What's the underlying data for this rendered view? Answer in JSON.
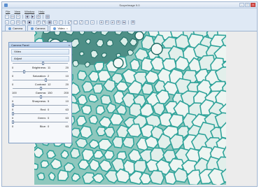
{
  "window": {
    "title": "ScopeImage 9.0",
    "minimize": "–",
    "maximize": "□",
    "close": "×"
  },
  "menu": [
    "File",
    "View",
    "Window",
    "Help"
  ],
  "toolbar": [
    {
      "icon": "new-icon",
      "glyph": "▫"
    },
    {
      "icon": "open-icon",
      "glyph": "▭"
    },
    {
      "icon": "save-icon",
      "glyph": "▪"
    },
    {
      "icon": "camera-icon",
      "glyph": "◉"
    },
    {
      "icon": "video-icon",
      "glyph": "▶"
    },
    {
      "icon": "snap-icon",
      "glyph": "◎"
    },
    {
      "icon": "print-icon",
      "glyph": "▤"
    }
  ],
  "toolbar2": [
    {
      "icon": "back-icon",
      "glyph": "←"
    },
    {
      "icon": "forward-icon",
      "glyph": "→"
    },
    {
      "icon": "cut-icon",
      "glyph": "✂"
    },
    {
      "icon": "copy-icon",
      "glyph": "❐"
    },
    {
      "icon": "paste-icon",
      "glyph": "▣"
    },
    {
      "icon": "undo-icon",
      "glyph": "↶"
    },
    {
      "icon": "redo-icon",
      "glyph": "↷"
    },
    {
      "icon": "grid-icon",
      "glyph": "▦"
    },
    {
      "icon": "zoom-in-icon",
      "glyph": "+"
    },
    {
      "icon": "zoom-out-icon",
      "glyph": "−"
    },
    {
      "icon": "fit-icon",
      "glyph": "⤢"
    },
    {
      "icon": "select-icon",
      "glyph": "⬚"
    },
    {
      "icon": "line-icon",
      "glyph": "╱"
    },
    {
      "icon": "rect-icon",
      "glyph": "□"
    },
    {
      "icon": "circle-icon",
      "glyph": "○"
    },
    {
      "icon": "text-icon",
      "glyph": "A"
    },
    {
      "icon": "measure-icon",
      "glyph": "⊢"
    },
    {
      "icon": "angle-icon",
      "glyph": "∠"
    },
    {
      "icon": "rotate-icon",
      "glyph": "⟳"
    },
    {
      "icon": "flip-icon",
      "glyph": "⇋"
    },
    {
      "icon": "settings-icon",
      "glyph": "⚙"
    }
  ],
  "tabs": [
    {
      "label": "Camera",
      "active": false
    },
    {
      "label": "Camera",
      "active": false
    },
    {
      "label": "Video",
      "active": true
    }
  ],
  "panel": {
    "title": "Camera Panel",
    "close": "×",
    "sections": [
      "Video",
      "Adjust"
    ],
    "adjustments": [
      {
        "name": "Brightness",
        "value": "11",
        "min": "0",
        "max": "20",
        "level": 0.55
      },
      {
        "name": "Saturation",
        "value": "2",
        "min": "0",
        "max": "10",
        "level": 0.2
      },
      {
        "name": "Contrast",
        "value": "12",
        "min": "0",
        "max": "20",
        "level": 0.6
      },
      {
        "name": "Gamma",
        "value": "150",
        "min": "100",
        "max": "200",
        "level": 0.5
      },
      {
        "name": "Sharpness",
        "value": "5",
        "min": "0",
        "max": "10",
        "level": 0.5
      },
      {
        "name": "Red",
        "value": "0",
        "min": "0",
        "max": "63",
        "level": 0.0
      },
      {
        "name": "Green",
        "value": "0",
        "min": "0",
        "max": "63",
        "level": 0.0
      },
      {
        "name": "Blue",
        "value": "0",
        "min": "0",
        "max": "63",
        "level": 0.0
      }
    ]
  },
  "colors": {
    "accent": "#5a8fd0",
    "tissue": "#2fa39a",
    "background": "#cfe3dc"
  }
}
